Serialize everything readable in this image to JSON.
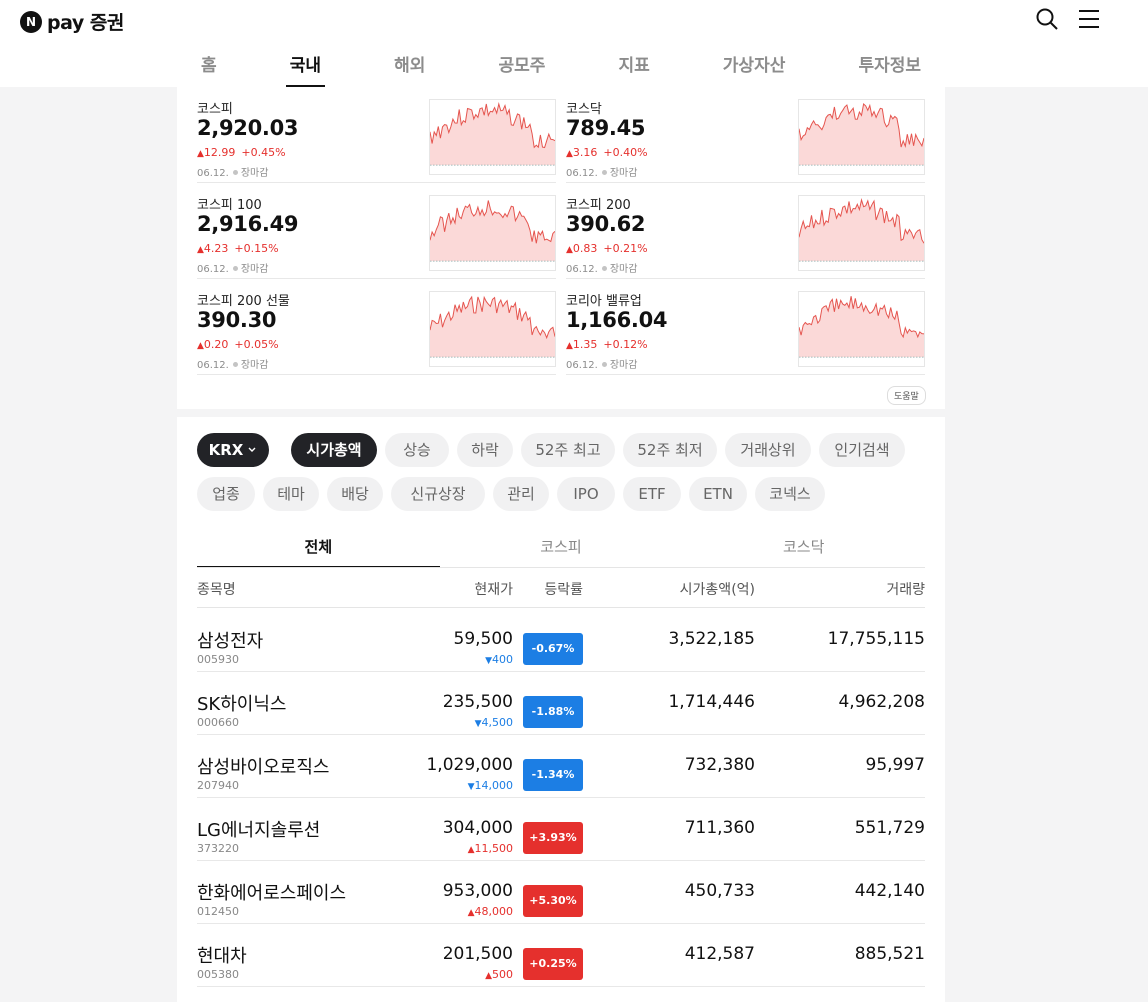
{
  "app": {
    "logo_badge": "N",
    "logo_text": "pay 증권"
  },
  "header": {
    "search_icon": "search-icon",
    "menu_icon": "menu-icon"
  },
  "nav": {
    "tabs": [
      "홈",
      "국내",
      "해외",
      "공모주",
      "지표",
      "가상자산",
      "투자정보"
    ],
    "active": "국내"
  },
  "indices": [
    {
      "name": "코스피",
      "value": "2,920.03",
      "change": "12.99",
      "rate": "+0.45%",
      "date": "06.12.",
      "status": "장마감"
    },
    {
      "name": "코스닥",
      "value": "789.45",
      "change": "3.16",
      "rate": "+0.40%",
      "date": "06.12.",
      "status": "장마감"
    },
    {
      "name": "코스피 100",
      "value": "2,916.49",
      "change": "4.23",
      "rate": "+0.15%",
      "date": "06.12.",
      "status": "장마감"
    },
    {
      "name": "코스피 200",
      "value": "390.62",
      "change": "0.83",
      "rate": "+0.21%",
      "date": "06.12.",
      "status": "장마감"
    },
    {
      "name": "코스피 200 선물",
      "value": "390.30",
      "change": "0.20",
      "rate": "+0.05%",
      "date": "06.12.",
      "status": "장마감"
    },
    {
      "name": "코리아 밸류업",
      "value": "1,166.04",
      "change": "1.35",
      "rate": "+0.12%",
      "date": "06.12.",
      "status": "장마감"
    }
  ],
  "help_label": "도움말",
  "filters": {
    "market_select": "KRX",
    "row1": [
      "시가총액",
      "상승",
      "하락",
      "52주 최고",
      "52주 최저",
      "거래상위",
      "인기검색"
    ],
    "row2": [
      "업종",
      "테마",
      "배당",
      "신규상장",
      "관리",
      "IPO",
      "ETF",
      "ETN",
      "코넥스"
    ],
    "active": "시가총액"
  },
  "subtabs": [
    "전체",
    "코스피",
    "코스닥"
  ],
  "table": {
    "headers": {
      "name": "종목명",
      "price": "현재가",
      "rate": "등락률",
      "cap": "시가총액(억)",
      "volume": "거래량"
    },
    "rows": [
      {
        "name": "삼성전자",
        "code": "005930",
        "price": "59,500",
        "diff": "400",
        "dir": "down",
        "rate": "-0.67%",
        "cap": "3,522,185",
        "volume": "17,755,115"
      },
      {
        "name": "SK하이닉스",
        "code": "000660",
        "price": "235,500",
        "diff": "4,500",
        "dir": "down",
        "rate": "-1.88%",
        "cap": "1,714,446",
        "volume": "4,962,208"
      },
      {
        "name": "삼성바이오로직스",
        "code": "207940",
        "price": "1,029,000",
        "diff": "14,000",
        "dir": "down",
        "rate": "-1.34%",
        "cap": "732,380",
        "volume": "95,997"
      },
      {
        "name": "LG에너지솔루션",
        "code": "373220",
        "price": "304,000",
        "diff": "11,500",
        "dir": "up",
        "rate": "+3.93%",
        "cap": "711,360",
        "volume": "551,729"
      },
      {
        "name": "한화에어로스페이스",
        "code": "012450",
        "price": "953,000",
        "diff": "48,000",
        "dir": "up",
        "rate": "+5.30%",
        "cap": "450,733",
        "volume": "442,140"
      },
      {
        "name": "현대차",
        "code": "005380",
        "price": "201,500",
        "diff": "500",
        "dir": "up",
        "rate": "+0.25%",
        "cap": "412,587",
        "volume": "885,521"
      }
    ]
  },
  "colors": {
    "up": "#e5302d",
    "down": "#1c7ee4",
    "chip_dark": "#222327"
  }
}
